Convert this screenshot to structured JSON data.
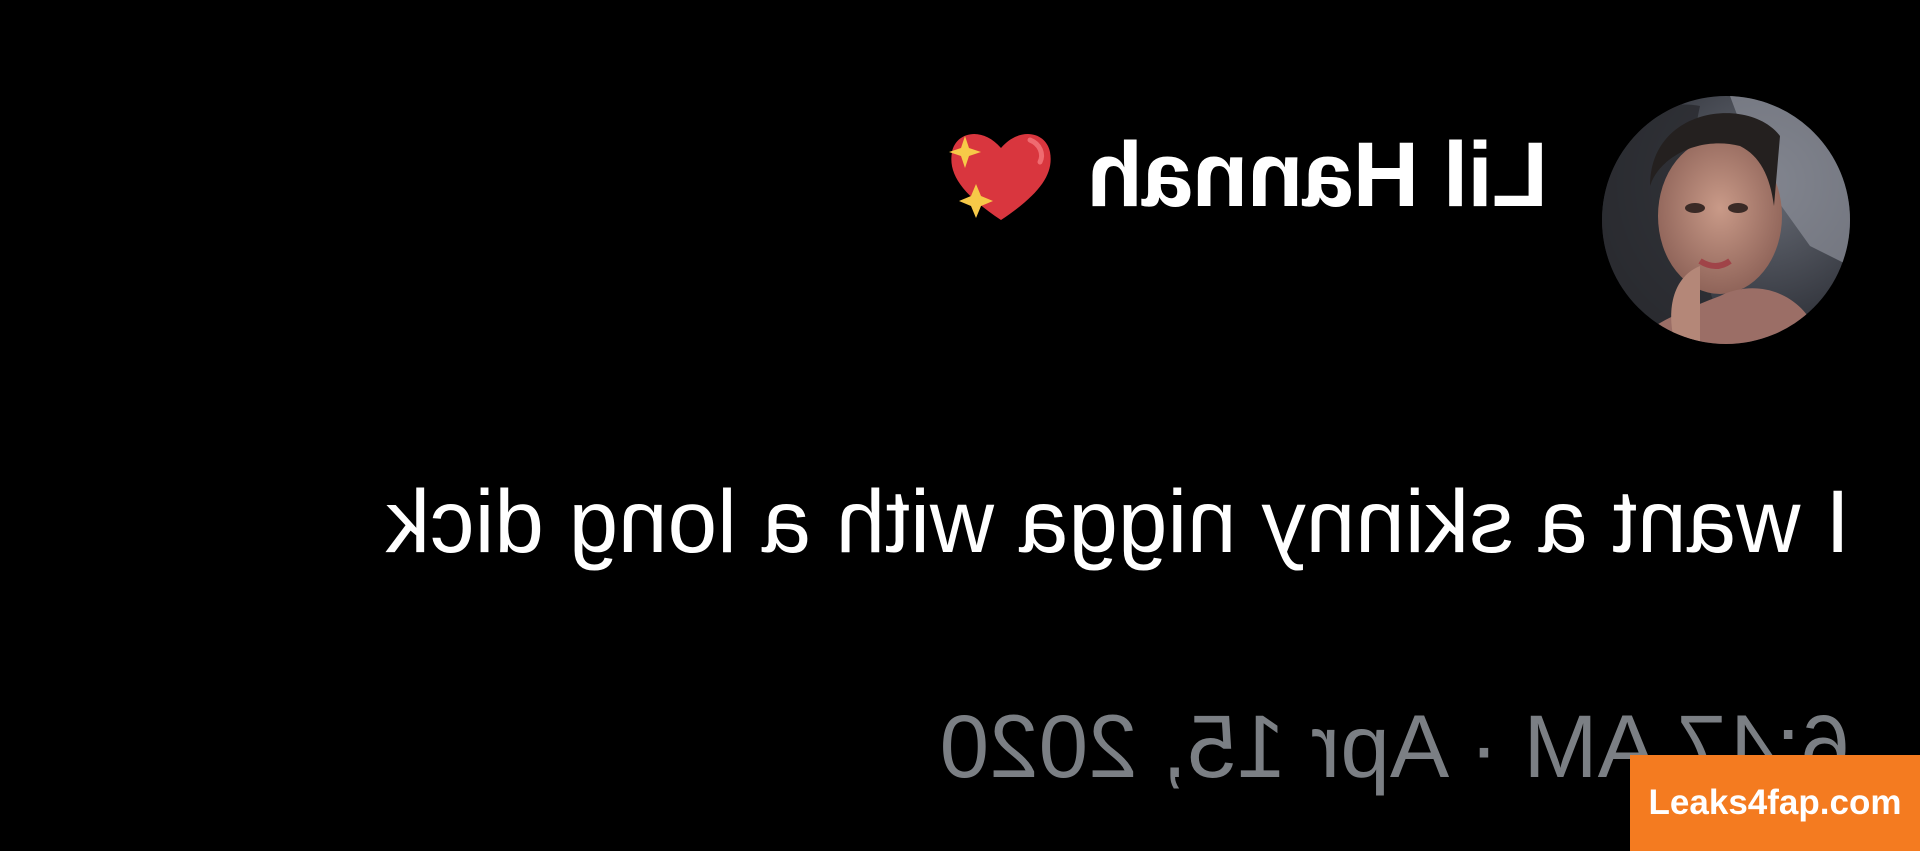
{
  "tweet": {
    "display_name": "Lil Hannah",
    "name_emoji": "sparkling-heart-icon",
    "text": "I want a skinny nigga with a long dick",
    "timestamp": "6:47 AM · Apr 15, 2020",
    "mirrored": true
  },
  "watermark": {
    "text": "Leaks4fap.com",
    "color": "#f47b20"
  },
  "colors": {
    "background": "#000000",
    "text": "#ffffff",
    "secondary_text": "#7b7f84",
    "heart": "#d9363e",
    "sparkle": "#f7c948"
  }
}
